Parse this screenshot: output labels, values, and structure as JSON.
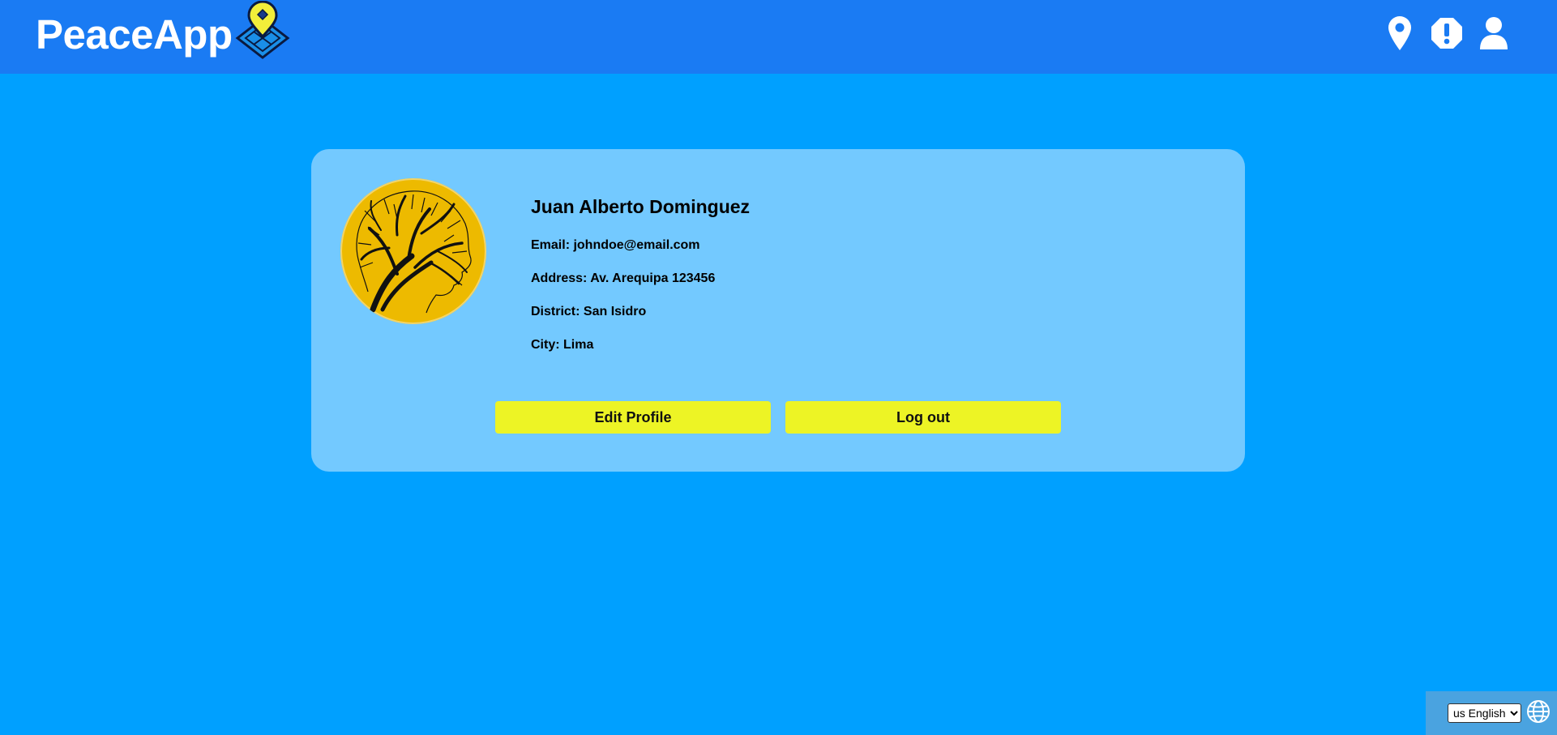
{
  "header": {
    "app_name": "PeaceApp",
    "nav": [
      {
        "name": "map-pin-icon"
      },
      {
        "name": "alert-icon"
      },
      {
        "name": "user-icon"
      }
    ]
  },
  "profile": {
    "name": "Juan Alberto Dominguez",
    "email": "Email: johndoe@email.com",
    "address": "Address: Av. Arequipa 123456",
    "district": "District: San Isidro",
    "city": "City: Lima",
    "edit_label": "Edit Profile",
    "logout_label": "Log out"
  },
  "language": {
    "selected": "us English",
    "icon": "globe-icon"
  },
  "colors": {
    "page_bg": "#00A0FF",
    "topbar_bg": "#1A7BF3",
    "card_bg": "#73C9FF",
    "button_bg": "#EDF425",
    "avatar_bg": "#EDBA00"
  }
}
